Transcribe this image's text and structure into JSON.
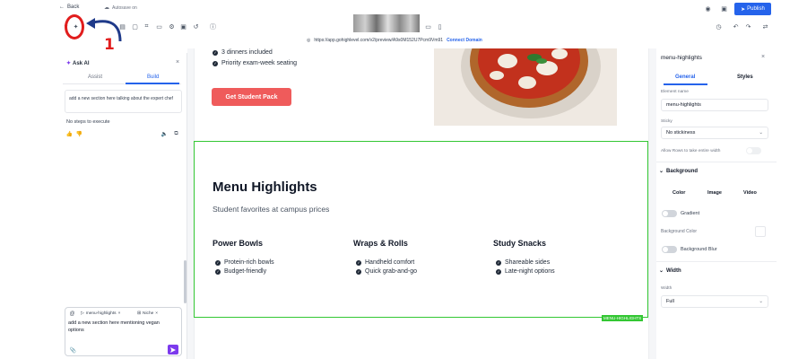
{
  "topbar": {
    "back_label": "Back",
    "autosave_label": "Autosave on",
    "publish_label": "Publish"
  },
  "url_bar": {
    "url": "https://app.gohighlevel.com/v2/preview/A9s0M152U7Pcm9Vm91",
    "connect_label": "Connect Domain"
  },
  "annotation": {
    "step_number": "1",
    "color": "#e11d1d"
  },
  "ask_ai": {
    "title": "Ask AI",
    "tabs": [
      "Assist",
      "Build"
    ],
    "active_tab": "Build",
    "message": "add a new section here talking about the expert chef",
    "status": "No steps to execute",
    "chips": [
      "menu-highlights",
      "Niche"
    ],
    "input_value": "add a new section here mentioning vegan options"
  },
  "canvas": {
    "top_bullets": [
      "3 dinners included",
      "Priority exam-week seating"
    ],
    "cta_label": "Get Student Pack",
    "section_label": "MENU-HIGHLIGHTS",
    "section_title": "Menu Highlights",
    "section_subtitle": "Student favorites at campus prices",
    "columns": [
      {
        "title": "Power Bowls",
        "items": [
          "Protein-rich bowls",
          "Budget-friendly"
        ]
      },
      {
        "title": "Wraps & Rolls",
        "items": [
          "Handheld comfort",
          "Quick grab-and-go"
        ]
      },
      {
        "title": "Study Snacks",
        "items": [
          "Shareable sides",
          "Late-night options"
        ]
      }
    ],
    "accent_color": "#ef5b5b",
    "selection_color": "#33c733"
  },
  "inspector": {
    "element_name": "menu-highlights",
    "tabs": [
      "General",
      "Styles"
    ],
    "active_tab": "General",
    "element_name_label": "Element name",
    "element_name_value": "menu-highlights",
    "sticky_label": "Sticky",
    "sticky_value": "No stickiness",
    "allow_rows_label": "Allow Rows to take entire width",
    "background_label": "Background",
    "bg_tabs": [
      "Color",
      "Image",
      "Video"
    ],
    "gradient_label": "Gradient",
    "bg_color_label": "Background Color",
    "bg_blur_label": "Background Blur",
    "width_section_label": "Width",
    "width_label": "Width",
    "width_value": "Full"
  }
}
